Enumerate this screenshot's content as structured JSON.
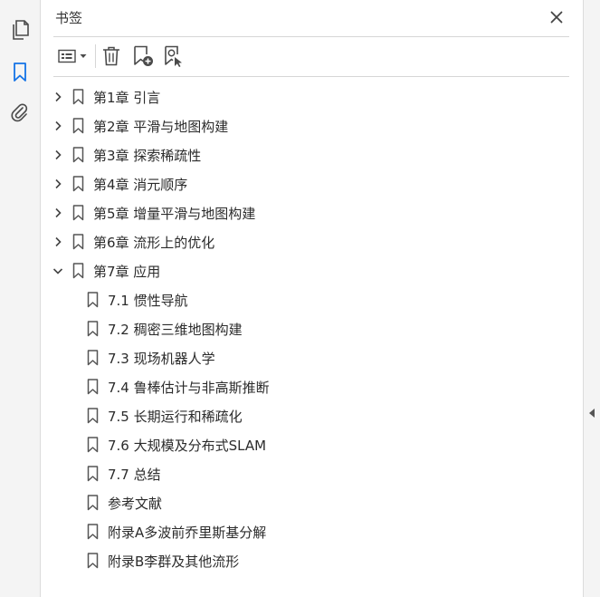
{
  "sidebar": {
    "tools": [
      {
        "icon": "pages-icon"
      },
      {
        "icon": "bookmark-icon",
        "active": true
      },
      {
        "icon": "attachment-icon"
      }
    ],
    "accent": "#1473e6"
  },
  "panel": {
    "title": "书签",
    "close_icon": "close-icon",
    "toolbar": {
      "options_icon": "options-list-icon",
      "delete_icon": "trash-icon",
      "new_bookmark_icon": "add-bookmark-icon",
      "bookmark_from_selection_icon": "bookmark-search-icon"
    }
  },
  "bookmarks": [
    {
      "label": "第1章 引言",
      "expandable": true,
      "expanded": false,
      "level": 0
    },
    {
      "label": "第2章 平滑与地图构建",
      "expandable": true,
      "expanded": false,
      "level": 0
    },
    {
      "label": "第3章 探索稀疏性",
      "expandable": true,
      "expanded": false,
      "level": 0
    },
    {
      "label": "第4章 消元顺序",
      "expandable": true,
      "expanded": false,
      "level": 0
    },
    {
      "label": "第5章 增量平滑与地图构建",
      "expandable": true,
      "expanded": false,
      "level": 0
    },
    {
      "label": "第6章 流形上的优化",
      "expandable": true,
      "expanded": false,
      "level": 0
    },
    {
      "label": "第7章 应用",
      "expandable": true,
      "expanded": true,
      "level": 0
    },
    {
      "label": "7.1 惯性导航",
      "expandable": false,
      "level": 1
    },
    {
      "label": "7.2 稠密三维地图构建",
      "expandable": false,
      "level": 1
    },
    {
      "label": "7.3 现场机器人学",
      "expandable": false,
      "level": 1
    },
    {
      "label": "7.4 鲁棒估计与非高斯推断",
      "expandable": false,
      "level": 1
    },
    {
      "label": "7.5 长期运行和稀疏化",
      "expandable": false,
      "level": 1
    },
    {
      "label": "7.6 大规模及分布式SLAM",
      "expandable": false,
      "level": 1
    },
    {
      "label": "7.7 总结",
      "expandable": false,
      "level": 1
    },
    {
      "label": "参考文献",
      "expandable": false,
      "level": 1
    },
    {
      "label": "附录A多波前乔里斯基分解",
      "expandable": false,
      "level": 1
    },
    {
      "label": "附录B李群及其他流形",
      "expandable": false,
      "level": 1
    }
  ]
}
